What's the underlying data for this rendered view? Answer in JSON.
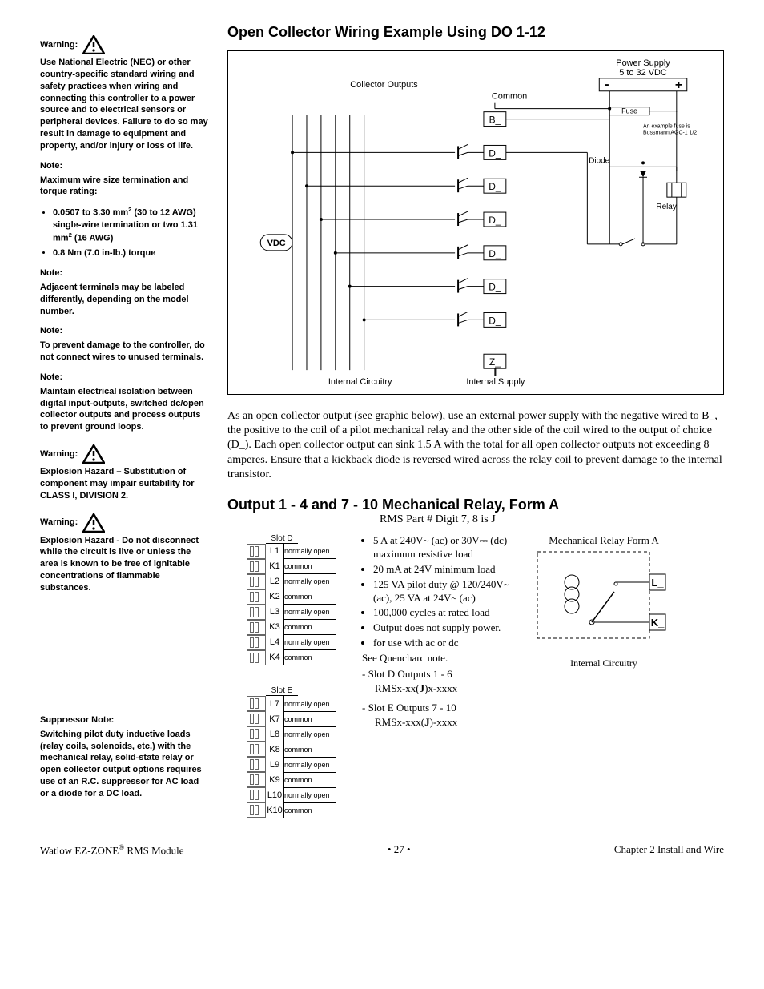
{
  "sidebar": {
    "warning1_label": "Warning:",
    "warning1_body": "Use National Electric (NEC) or other country-specific standard wiring and safety practices when wiring and connecting this controller to a power source and to electrical sensors or peripheral devices. Failure to do so may result in damage to equipment and property, and/or injury or loss of life.",
    "note1_label": "Note:",
    "note1_body": "Maximum wire size termination and torque rating:",
    "note1_b1a": "0.0507 to 3.30 mm",
    "note1_b1b": " (30 to 12 AWG) single-wire termination or two 1.31 mm",
    "note1_b1c": " (16 AWG)",
    "note1_b2": "0.8 Nm (7.0 in-lb.) torque",
    "note2_label": "Note:",
    "note2_body": "Adjacent terminals may be labeled differently, depending on the model number.",
    "note3_label": "Note:",
    "note3_body": "To prevent damage to the controller, do not connect wires to unused terminals.",
    "note4_label": "Note:",
    "note4_body": "Maintain electrical isolation between digital input-outputs, switched dc/open collector outputs and process outputs to prevent ground loops.",
    "warning2_label": "Warning:",
    "warning2_body": "Explosion Hazard – Substitution of component may impair suitability for CLASS I, DIVISION 2.",
    "warning3_label": "Warning:",
    "warning3_body": "Explosion Hazard - Do not disconnect while the circuit is live or unless the area is known to be free of ignitable concentrations of flammable substances.",
    "supp_label": "Suppressor Note:",
    "supp_body": "Switching pilot duty inductive loads (relay coils, solenoids, etc.) with the mechanical relay, solid-state relay or open collector output options requires use of an R.C. suppressor for AC load or a diode for a DC load."
  },
  "section1": {
    "title": "Open Collector Wiring Example Using DO 1-12",
    "diagram": {
      "collector_outputs": "Collector Outputs",
      "common": "Common",
      "vdc": "VDC",
      "internal_circuitry": "Internal Circuitry",
      "internal_supply": "Internal Supply",
      "power_supply_l1": "Power Supply",
      "power_supply_l2": "5 to 32 VDC",
      "fuse": "Fuse",
      "fuse_note_l1": "An example fuse is",
      "fuse_note_l2": "Bussmann AGC-1 1/2",
      "diode": "Diode",
      "relay": "Relay",
      "minus": "-",
      "plus": "+",
      "terms": [
        "B_",
        "D_",
        "D_",
        "D_",
        "D_",
        "D_",
        "D_",
        "Z_"
      ]
    },
    "body": "As an open collector output (see graphic below), use an external power supply with the negative wired to B_, the positive to the coil of a pilot mechanical relay and the other side of the coil wired to the output of choice (D_). Each open collector output can sink 1.5 A with the total for all open collector outputs not exceeding 8 amperes. Ensure that a kickback diode is reversed wired across the relay coil to prevent damage to the internal transistor."
  },
  "section2": {
    "title": "Output 1 - 4 and 7 - 10 Mechanical Relay, Form A",
    "subtitle": "RMS Part # Digit 7, 8 is J",
    "slotD_title": "Slot D",
    "slotE_title": "Slot E",
    "slotD_rows": [
      {
        "t": "L1",
        "d": "normally open"
      },
      {
        "t": "K1",
        "d": "common"
      },
      {
        "t": "L2",
        "d": "normally open"
      },
      {
        "t": "K2",
        "d": "common"
      },
      {
        "t": "L3",
        "d": "normally open"
      },
      {
        "t": "K3",
        "d": "common"
      },
      {
        "t": "L4",
        "d": "normally open"
      },
      {
        "t": "K4",
        "d": "common"
      }
    ],
    "slotE_rows": [
      {
        "t": "L7",
        "d": "normally open"
      },
      {
        "t": "K7",
        "d": "common"
      },
      {
        "t": "L8",
        "d": "normally open"
      },
      {
        "t": "K8",
        "d": "common"
      },
      {
        "t": "L9",
        "d": "normally open"
      },
      {
        "t": "K9",
        "d": "common"
      },
      {
        "t": "L10",
        "d": "normally open"
      },
      {
        "t": "K10",
        "d": "common"
      }
    ],
    "specs": {
      "b1": "5 A at 240V~ (ac) or 30V⎓ (dc) maximum resistive load",
      "b2": "20 mA at 24V minimum load",
      "b3": "125 VA pilot duty @ 120/240V~ (ac), 25 VA at 24V~ (ac)",
      "b4": "100,000 cycles at rated load",
      "b5": "Output does not supply power.",
      "b6": "for use with ac or dc",
      "quench": "See Quencharc note.",
      "s1": "Slot D Outputs 1 - 6",
      "s1_part_a": "RMSx-xx(",
      "s1_part_b": ")x-xxxx",
      "s2": "Slot E Outputs 7 - 10",
      "s2_part_a": "RMSx-xxx(",
      "s2_part_b": ")-xxxx",
      "bold_j": "J"
    },
    "relay_fig": {
      "caption": "Mechanical Relay Form A",
      "l": "L_",
      "k": "K_",
      "internal": "Internal Circuitry"
    }
  },
  "footer": {
    "left_a": "Watlow EZ-ZONE",
    "left_b": " RMS Module",
    "center": "• 27 •",
    "right": "Chapter 2 Install and Wire"
  }
}
